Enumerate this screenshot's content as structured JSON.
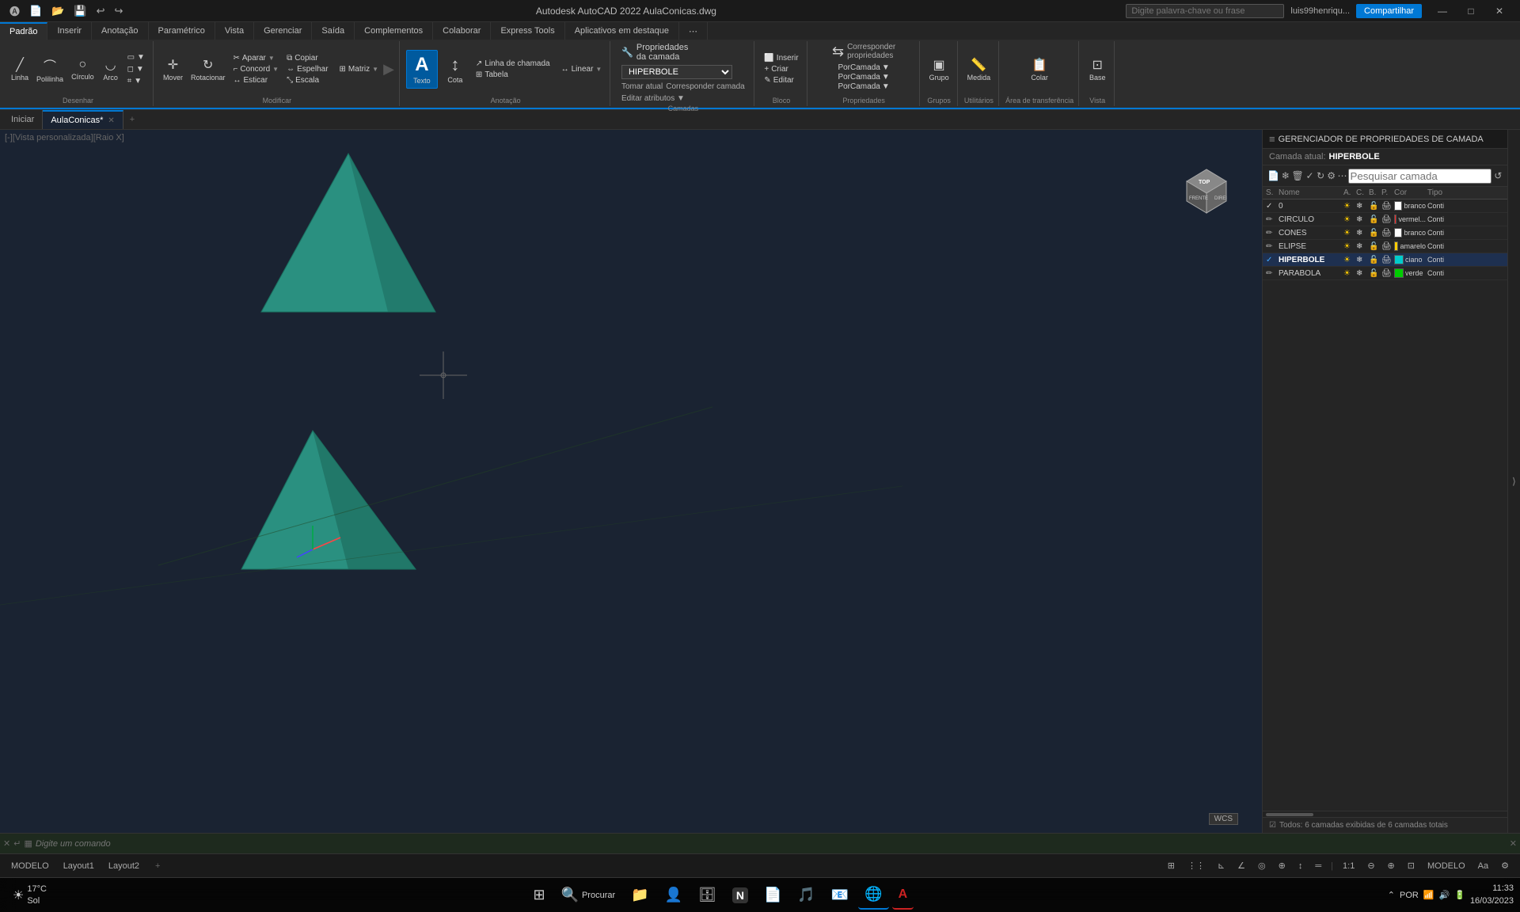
{
  "titlebar": {
    "app_name": "Autodesk AutoCAD 2022",
    "file_name": "AulaConicas.dwg",
    "title": "Autodesk AutoCAD 2022  AulaConicas.dwg",
    "share_label": "Compartilhar",
    "search_placeholder": "Digite palavra-chave ou frase",
    "user": "luis99henriqu...",
    "minimize": "—",
    "maximize": "□",
    "close": "✕"
  },
  "ribbon": {
    "tabs": [
      {
        "label": "Padrão",
        "active": true
      },
      {
        "label": "Inserir",
        "active": false
      },
      {
        "label": "Anotação",
        "active": false
      },
      {
        "label": "Paramétrico",
        "active": false
      },
      {
        "label": "Vista",
        "active": false
      },
      {
        "label": "Gerenciar",
        "active": false
      },
      {
        "label": "Saída",
        "active": false
      },
      {
        "label": "Complementos",
        "active": false
      },
      {
        "label": "Colaborar",
        "active": false
      },
      {
        "label": "Express Tools",
        "active": false
      },
      {
        "label": "Aplicativos em destaque",
        "active": false
      }
    ],
    "groups": {
      "draw": {
        "label": "Desenhar",
        "items": [
          "Linha",
          "Polilinha",
          "Círculo",
          "Arco"
        ]
      },
      "modify": {
        "label": "Modificar",
        "items": [
          "Mover",
          "Rotacionar",
          "Copiar",
          "Espelhar",
          "Aparar",
          "Concord",
          "Esticar",
          "Escala",
          "Matriz"
        ]
      },
      "annotation": {
        "label": "Anotação",
        "items": [
          "Texto",
          "Cota",
          "Linha de chamada",
          "Tabela"
        ]
      },
      "layers": {
        "label": "Camadas",
        "active_layer": "HIPERBOLE"
      },
      "block": {
        "label": "Bloco",
        "items": [
          "Inserir",
          "Criar",
          "Editar"
        ]
      },
      "properties": {
        "label": "Propriedades",
        "items": [
          "Propriedades da camada",
          "Corresponder propriedades"
        ]
      }
    }
  },
  "canvas": {
    "view_label": "[-][Vista personalizada][Raio X]",
    "wcs_label": "WCS"
  },
  "tabs": {
    "items": [
      {
        "label": "Iniciar",
        "active": false,
        "closeable": false
      },
      {
        "label": "AulaConicas*",
        "active": true,
        "closeable": true
      }
    ],
    "add_label": "+"
  },
  "layer_panel": {
    "title": "GERENCIADOR DE PROPRIEDADES DE CAMADA",
    "current_layer_label": "Camada atual:",
    "current_layer_value": "HIPERBOLE",
    "search_placeholder": "Pesquisar camada",
    "columns": {
      "s": "S.",
      "name": "Nome",
      "a": "A.",
      "c": "C.",
      "b": "B.",
      "p": "P.",
      "cor": "Cor",
      "tipo": "Tipo"
    },
    "layers": [
      {
        "name": "0",
        "on": true,
        "frozen": false,
        "locked": false,
        "color": "#ffffff",
        "color_name": "branco",
        "linetype": "Conti",
        "active": false
      },
      {
        "name": "CIRCULO",
        "on": true,
        "frozen": false,
        "locked": false,
        "color": "#ff2222",
        "color_name": "vermel...",
        "linetype": "Conti",
        "active": false
      },
      {
        "name": "CONES",
        "on": true,
        "frozen": false,
        "locked": false,
        "color": "#ffffff",
        "color_name": "branco",
        "linetype": "Conti",
        "active": false
      },
      {
        "name": "ELIPSE",
        "on": true,
        "frozen": false,
        "locked": false,
        "color": "#ffcc00",
        "color_name": "amarelo",
        "linetype": "Conti",
        "active": false
      },
      {
        "name": "HIPERBOLE",
        "on": true,
        "frozen": false,
        "locked": false,
        "color": "#00cccc",
        "color_name": "ciano",
        "linetype": "Conti",
        "active": true
      },
      {
        "name": "PARABOLA",
        "on": true,
        "frozen": false,
        "locked": false,
        "color": "#00cc00",
        "color_name": "verde",
        "linetype": "Conti",
        "active": false
      }
    ],
    "footer": "Todos: 6 camadas exibidas de 6 camadas totais"
  },
  "command_bar": {
    "placeholder": "Digite um comando"
  },
  "status_bar": {
    "model_label": "MODELO",
    "buttons": [
      "MODEL",
      "Layout1",
      "Layout2"
    ]
  },
  "taskbar": {
    "weather": "17°C\nSol",
    "weather_icon": "☀",
    "apps": [
      {
        "icon": "⊞",
        "label": "Windows"
      },
      {
        "icon": "🔍",
        "label": "Procurar"
      },
      {
        "icon": "📁",
        "label": "Explorer"
      },
      {
        "icon": "👤",
        "label": "Teams"
      },
      {
        "icon": "🗄",
        "label": "Storage"
      },
      {
        "icon": "W",
        "label": "Word"
      },
      {
        "icon": "🎵",
        "label": "Spotify"
      },
      {
        "icon": "📧",
        "label": "Mail"
      },
      {
        "icon": "🌐",
        "label": "Edge"
      },
      {
        "icon": "A",
        "label": "AutoCAD"
      }
    ],
    "systray": {
      "language": "POR",
      "wifi": "📶",
      "volume": "🔊",
      "battery": "🔋",
      "time": "11:33",
      "date": "16/03/2023"
    }
  }
}
